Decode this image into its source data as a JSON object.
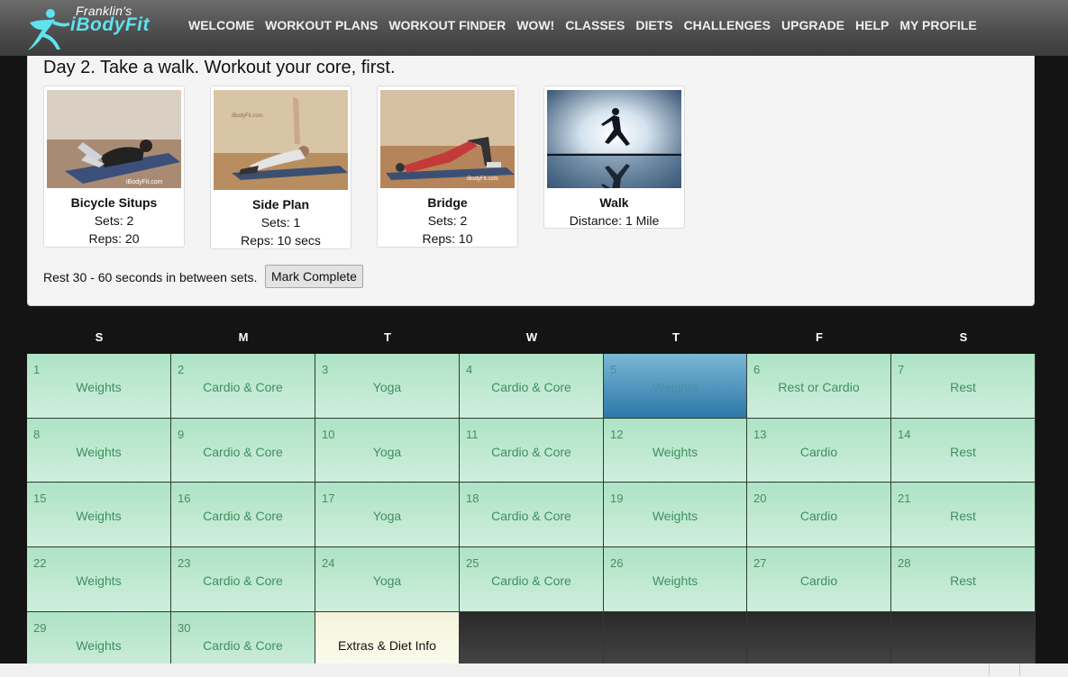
{
  "brand": {
    "small": "Franklin's",
    "big": "iBodyFit"
  },
  "nav": [
    "WELCOME",
    "WORKOUT PLANS",
    "WORKOUT FINDER",
    "WOW!",
    "CLASSES",
    "DIETS",
    "CHALLENGES",
    "UPGRADE",
    "HELP",
    "MY PROFILE"
  ],
  "workout": {
    "title": "Day 2. Take a walk. Workout your core, first.",
    "exercises": [
      {
        "name": "Bicycle Situps",
        "line1": "Sets: 2",
        "line2": "Reps: 20"
      },
      {
        "name": "Side Plan",
        "line1": "Sets: 1",
        "line2": "Reps: 10 secs"
      },
      {
        "name": "Bridge",
        "line1": "Sets: 2",
        "line2": "Reps: 10"
      },
      {
        "name": "Walk",
        "line1": "Distance: 1 Mile",
        "line2": ""
      }
    ],
    "rest_note": "Rest 30 - 60 seconds in between sets.",
    "mark_complete": "Mark Complete"
  },
  "calendar": {
    "weekdays": [
      "S",
      "M",
      "T",
      "W",
      "T",
      "F",
      "S"
    ],
    "days": [
      {
        "n": "1",
        "label": "Weights"
      },
      {
        "n": "2",
        "label": "Cardio & Core"
      },
      {
        "n": "3",
        "label": "Yoga"
      },
      {
        "n": "4",
        "label": "Cardio & Core"
      },
      {
        "n": "5",
        "label": "Weights"
      },
      {
        "n": "6",
        "label": "Rest or Cardio"
      },
      {
        "n": "7",
        "label": "Rest"
      },
      {
        "n": "8",
        "label": "Weights"
      },
      {
        "n": "9",
        "label": "Cardio & Core"
      },
      {
        "n": "10",
        "label": "Yoga"
      },
      {
        "n": "11",
        "label": "Cardio & Core"
      },
      {
        "n": "12",
        "label": "Weights"
      },
      {
        "n": "13",
        "label": "Cardio"
      },
      {
        "n": "14",
        "label": "Rest"
      },
      {
        "n": "15",
        "label": "Weights"
      },
      {
        "n": "16",
        "label": "Cardio & Core"
      },
      {
        "n": "17",
        "label": "Yoga"
      },
      {
        "n": "18",
        "label": "Cardio & Core"
      },
      {
        "n": "19",
        "label": "Weights"
      },
      {
        "n": "20",
        "label": "Cardio"
      },
      {
        "n": "21",
        "label": "Rest"
      },
      {
        "n": "22",
        "label": "Weights"
      },
      {
        "n": "23",
        "label": "Cardio & Core"
      },
      {
        "n": "24",
        "label": "Yoga"
      },
      {
        "n": "25",
        "label": "Cardio & Core"
      },
      {
        "n": "26",
        "label": "Weights"
      },
      {
        "n": "27",
        "label": "Cardio"
      },
      {
        "n": "28",
        "label": "Rest"
      },
      {
        "n": "29",
        "label": "Weights"
      },
      {
        "n": "30",
        "label": "Cardio & Core"
      }
    ],
    "extras_label": "Extras & Diet Info",
    "highlighted_day": "5"
  },
  "colors": {
    "brand_accent": "#5fe2ee",
    "cell_green": "#aee3c4",
    "today_blue": "#2c78a8"
  }
}
